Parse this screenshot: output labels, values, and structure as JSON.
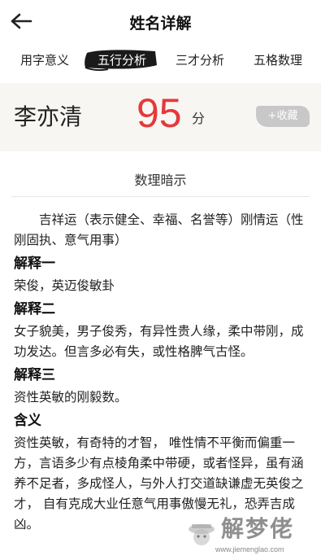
{
  "header": {
    "title": "姓名详解"
  },
  "tabs": [
    {
      "label": "用字意义"
    },
    {
      "label": "五行分析"
    },
    {
      "label": "三才分析"
    },
    {
      "label": "五格数理"
    }
  ],
  "result": {
    "name": "李亦清",
    "score": "95",
    "unit": "分",
    "favorite_label": "+收藏"
  },
  "section": {
    "title": "数理暗示",
    "intro": "吉祥运（表示健全、幸福、名誉等）刚情运（性刚固执、意气用事）",
    "blocks": [
      {
        "heading": "解释一",
        "text": "荣俊，英迈俊敏卦"
      },
      {
        "heading": "解释二",
        "text": "女子貌美，男子俊秀，有异性贵人缘，柔中带刚，成功发达。但言多必有失，或性格脾气古怪。"
      },
      {
        "heading": "解释三",
        "text": "资性英敏的刚毅数。"
      },
      {
        "heading": "含义",
        "text": "资性英敏，有奇特的才智， 唯性情不平衡而偏重一方，言语多少有点棱角柔中带硬，或者怪异，虽有涵养不足者，多成怪人，与外人打交道缺谦虚无英俊之才， 自有克成大业任意气用事傲慢无礼，恐弄吉成凶。"
      }
    ]
  },
  "watermark": {
    "text": "解梦佬",
    "url": "www.jiemenglao.com"
  }
}
